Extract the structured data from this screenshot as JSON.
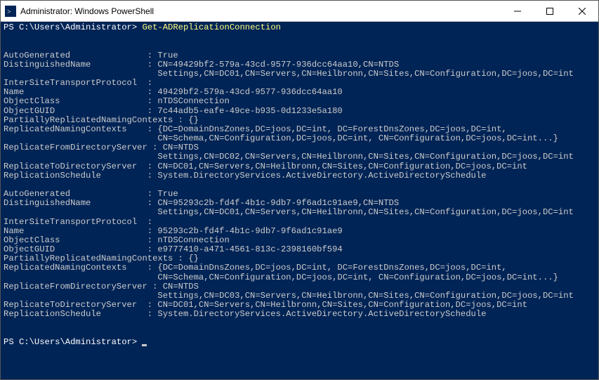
{
  "window_title": "Administrator: Windows PowerShell",
  "prompt": "PS C:\\Users\\Administrator>",
  "command": "Get-ADReplicationConnection",
  "key_col_width": 27,
  "records": [
    {
      "AutoGenerated": "True",
      "DistinguishedName": "CN=49429bf2-579a-43cd-9577-936dcc64aa10,CN=NTDS\nSettings,CN=DC01,CN=Servers,CN=Heilbronn,CN=Sites,CN=Configuration,DC=joos,DC=int",
      "InterSiteTransportProtocol": "",
      "Name": "49429bf2-579a-43cd-9577-936dcc64aa10",
      "ObjectClass": "nTDSConnection",
      "ObjectGUID": "7c44adb5-eafe-49ce-b935-0d1233e5a180",
      "PartiallyReplicatedNamingContexts": "{}",
      "ReplicatedNamingContexts": "{DC=DomainDnsZones,DC=joos,DC=int, DC=ForestDnsZones,DC=joos,DC=int,\nCN=Schema,CN=Configuration,DC=joos,DC=int, CN=Configuration,DC=joos,DC=int...}",
      "ReplicateFromDirectoryServer": "CN=NTDS\nSettings,CN=DC02,CN=Servers,CN=Heilbronn,CN=Sites,CN=Configuration,DC=joos,DC=int",
      "ReplicateToDirectoryServer": "CN=DC01,CN=Servers,CN=Heilbronn,CN=Sites,CN=Configuration,DC=joos,DC=int",
      "ReplicationSchedule": "System.DirectoryServices.ActiveDirectory.ActiveDirectorySchedule"
    },
    {
      "AutoGenerated": "True",
      "DistinguishedName": "CN=95293c2b-fd4f-4b1c-9db7-9f6ad1c91ae9,CN=NTDS\nSettings,CN=DC01,CN=Servers,CN=Heilbronn,CN=Sites,CN=Configuration,DC=joos,DC=int",
      "InterSiteTransportProtocol": "",
      "Name": "95293c2b-fd4f-4b1c-9db7-9f6ad1c91ae9",
      "ObjectClass": "nTDSConnection",
      "ObjectGUID": "e9777410-a471-4561-813c-2398160bf594",
      "PartiallyReplicatedNamingContexts": "{}",
      "ReplicatedNamingContexts": "{DC=DomainDnsZones,DC=joos,DC=int, DC=ForestDnsZones,DC=joos,DC=int,\nCN=Schema,CN=Configuration,DC=joos,DC=int, CN=Configuration,DC=joos,DC=int...}",
      "ReplicateFromDirectoryServer": "CN=NTDS\nSettings,CN=DC03,CN=Servers,CN=Heilbronn,CN=Sites,CN=Configuration,DC=joos,DC=int",
      "ReplicateToDirectoryServer": "CN=DC01,CN=Servers,CN=Heilbronn,CN=Sites,CN=Configuration,DC=joos,DC=int",
      "ReplicationSchedule": "System.DirectoryServices.ActiveDirectory.ActiveDirectorySchedule"
    }
  ]
}
